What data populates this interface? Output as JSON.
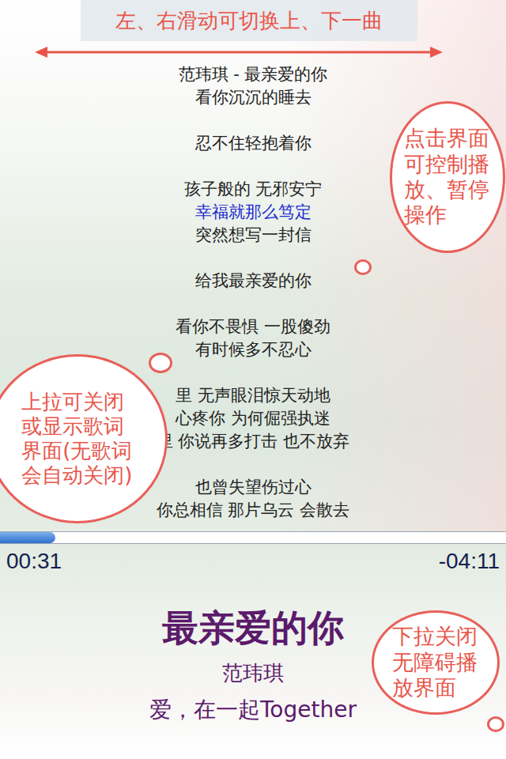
{
  "hint": {
    "text": "左、右滑动可切换上、下一曲"
  },
  "lyrics": {
    "stanzas": [
      [
        {
          "text": "范玮琪 - 最亲爱的你",
          "selected": false
        },
        {
          "text": "看你沉沉的睡去",
          "selected": false
        }
      ],
      [
        {
          "text": "忍不住轻抱着你",
          "selected": false
        }
      ],
      [
        {
          "text": "孩子般的 无邪安宁",
          "selected": false
        },
        {
          "text": "幸福就那么笃定",
          "selected": true
        },
        {
          "text": "突然想写一封信",
          "selected": false
        }
      ],
      [
        {
          "text": "给我最亲爱的你",
          "selected": false
        }
      ],
      [
        {
          "text": "看你不畏惧 一股傻劲",
          "selected": false
        },
        {
          "text": "有时候多不忍心",
          "selected": false
        }
      ],
      [
        {
          "text": "里 无声眼泪惊天动地",
          "selected": false
        },
        {
          "text": "心疼你 为何倔强执迷",
          "selected": false
        },
        {
          "text": "里 你说再多打击 也不放弃",
          "selected": false
        }
      ],
      [
        {
          "text": "也曾失望伤过心",
          "selected": false
        },
        {
          "text": "你总相信 那片乌云 会散去",
          "selected": false
        }
      ]
    ]
  },
  "callouts": {
    "tap": "点击界面可控制播放、暂停操作",
    "lyrics": "上拉可关闭或显示歌词界面(无歌词会自动关闭)",
    "close": "下拉关闭无障碍播放界面"
  },
  "progress": {
    "level": 0.11,
    "elapsed": "00:31",
    "remaining": "-04:11"
  },
  "now_playing": {
    "title": "最亲爱的你",
    "artist": "范玮琪",
    "album": "爱，在一起Together"
  }
}
